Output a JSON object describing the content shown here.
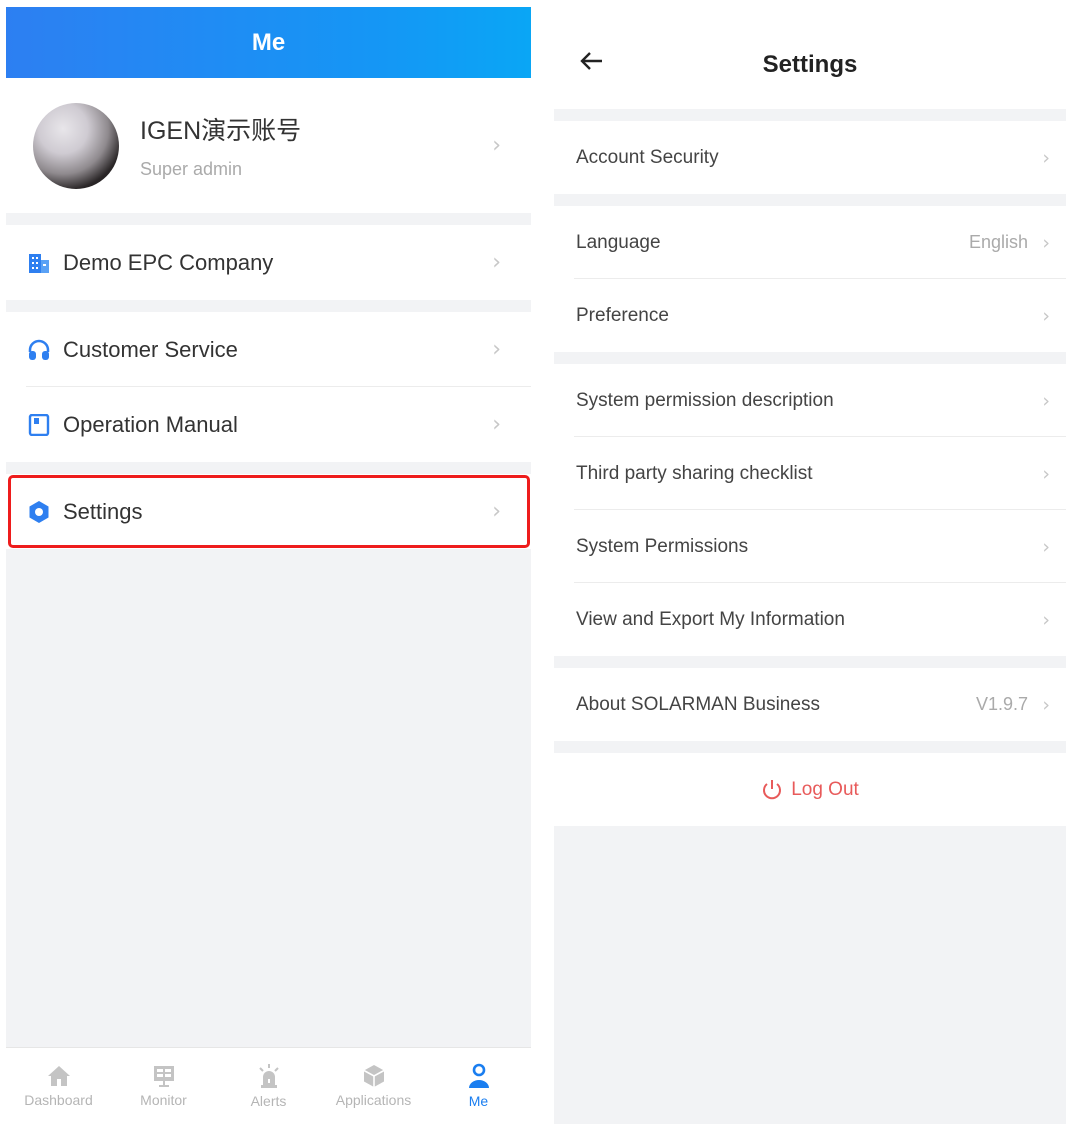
{
  "me_screen": {
    "header_title": "Me",
    "profile": {
      "name": "IGEN演示账号",
      "role": "Super admin"
    },
    "company": {
      "label": "Demo EPC Company",
      "icon": "building-icon"
    },
    "customer_service": {
      "label": "Customer Service",
      "icon": "headset-icon"
    },
    "operation_manual": {
      "label": "Operation Manual",
      "icon": "book-icon"
    },
    "settings": {
      "label": "Settings",
      "icon": "gear-icon"
    },
    "tabs": [
      {
        "label": "Dashboard",
        "icon": "home-icon"
      },
      {
        "label": "Monitor",
        "icon": "monitor-icon"
      },
      {
        "label": "Alerts",
        "icon": "alarm-icon"
      },
      {
        "label": "Applications",
        "icon": "cube-icon"
      },
      {
        "label": "Me",
        "icon": "user-icon",
        "active": true
      }
    ]
  },
  "settings_screen": {
    "title": "Settings",
    "items": {
      "account_security": {
        "label": "Account Security"
      },
      "language": {
        "label": "Language",
        "value": "English"
      },
      "preference": {
        "label": "Preference"
      },
      "permission_description": {
        "label": "System permission description"
      },
      "third_party": {
        "label": "Third party sharing checklist"
      },
      "system_permissions": {
        "label": "System Permissions"
      },
      "export_info": {
        "label": "View and Export My Information"
      },
      "about": {
        "label": "About SOLARMAN Business",
        "value": "V1.9.7"
      }
    },
    "logout_label": "Log Out"
  },
  "colors": {
    "accent": "#1a7ef0",
    "header_gradient_start": "#2d7ff2",
    "header_gradient_end": "#0aa6f5",
    "highlight_border": "#ee1c1c",
    "logout": "#e85a5a",
    "background": "#f2f3f5"
  }
}
